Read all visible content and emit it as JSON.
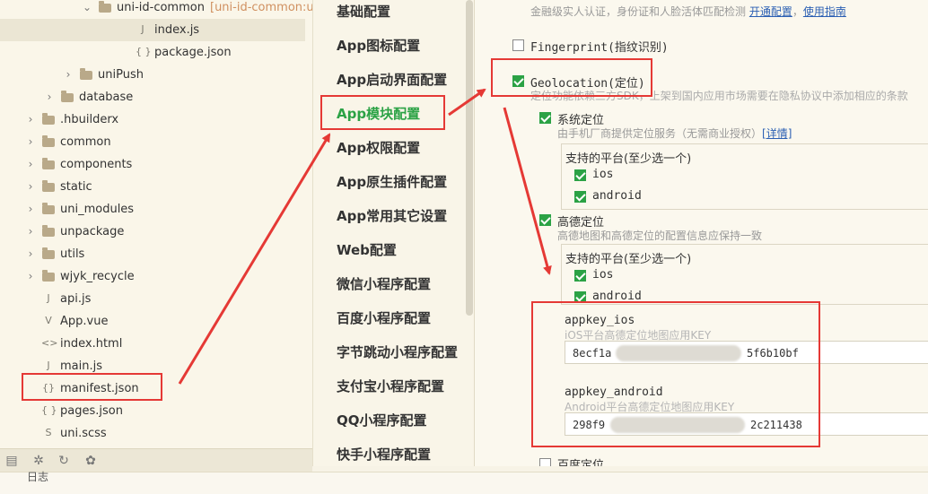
{
  "tree": {
    "rows": [
      {
        "label": "uni-id-common",
        "sublabel": "[uni-id-common:ur",
        "depth": 5,
        "type": "folder",
        "expanded": true
      },
      {
        "label": "index.js",
        "depth": 7,
        "type": "js",
        "selected": true
      },
      {
        "label": "package.json",
        "depth": 7,
        "type": "json"
      },
      {
        "label": "uniPush",
        "depth": 4,
        "type": "folder",
        "expanded": false
      },
      {
        "label": "database",
        "depth": 3,
        "type": "folder",
        "expanded": false
      },
      {
        "label": ".hbuilderx",
        "depth": 2,
        "type": "folder",
        "expanded": false
      },
      {
        "label": "common",
        "depth": 2,
        "type": "folder",
        "expanded": false
      },
      {
        "label": "components",
        "depth": 2,
        "type": "folder",
        "expanded": false
      },
      {
        "label": "static",
        "depth": 2,
        "type": "folder",
        "expanded": false
      },
      {
        "label": "uni_modules",
        "depth": 2,
        "type": "folder",
        "expanded": false
      },
      {
        "label": "unpackage",
        "depth": 2,
        "type": "folder",
        "expanded": false
      },
      {
        "label": "utils",
        "depth": 2,
        "type": "folder",
        "expanded": false
      },
      {
        "label": "wjyk_recycle",
        "depth": 2,
        "type": "folder",
        "expanded": false
      },
      {
        "label": "api.js",
        "depth": 2,
        "type": "js"
      },
      {
        "label": "App.vue",
        "depth": 2,
        "type": "vue"
      },
      {
        "label": "index.html",
        "depth": 2,
        "type": "html"
      },
      {
        "label": "main.js",
        "depth": 2,
        "type": "js"
      },
      {
        "label": "manifest.json",
        "depth": 2,
        "type": "manifest",
        "highlight": true
      },
      {
        "label": "pages.json",
        "depth": 2,
        "type": "json"
      },
      {
        "label": "uni.scss",
        "depth": 2,
        "type": "scss"
      }
    ]
  },
  "statusbar": {
    "icons": [
      "files-icon",
      "bug-icon",
      "search-replace-icon",
      "plugin-icon"
    ]
  },
  "menu": {
    "items": [
      "基础配置",
      "App图标配置",
      "App启动界面配置",
      "App模块配置",
      "App权限配置",
      "App原生插件配置",
      "App常用其它设置",
      "Web配置",
      "微信小程序配置",
      "百度小程序配置",
      "字节跳动小程序配置",
      "支付宝小程序配置",
      "QQ小程序配置",
      "快手小程序配置"
    ],
    "active_index": 3
  },
  "settings": {
    "top_hint": "金融级实人认证，身份证和人脸活体匹配检测",
    "top_link1": "开通配置",
    "top_sep": "，",
    "top_link2": "使用指南",
    "fingerprint_label": "Fingerprint(指纹识别)",
    "fingerprint_checked": false,
    "geo_label": "Geolocation(定位)",
    "geo_checked": true,
    "geo_hint": "定位功能依赖三方SDK，上架到国内应用市场需要在隐私协议中添加相应的条款",
    "system_label": "系统定位",
    "system_checked": true,
    "system_hint": "由手机厂商提供定位服务（无需商业授权）",
    "system_link": "[详情]",
    "platform_title": "支持的平台(至少选一个)",
    "sys_platforms": [
      {
        "name": "ios",
        "checked": true
      },
      {
        "name": "android",
        "checked": true
      }
    ],
    "amap_label": "高德定位",
    "amap_checked": true,
    "amap_hint": "高德地图和高德定位的配置信息应保持一致",
    "amap_platform_title": "支持的平台(至少选一个)",
    "amap_platforms": [
      {
        "name": "ios",
        "checked": true
      },
      {
        "name": "android",
        "checked": true
      }
    ],
    "appkey_ios_label": "appkey_ios",
    "appkey_ios_hint": "iOS平台高德定位地图应用KEY",
    "appkey_ios_prefix": "8ecf1a",
    "appkey_ios_suffix": "5f6b10bf",
    "appkey_android_label": "appkey_android",
    "appkey_android_hint": "Android平台高德定位地图应用KEY",
    "appkey_android_prefix": "298f9",
    "appkey_android_suffix": "2c211438",
    "baidu_label": "百度定位",
    "baidu_checked": false
  },
  "bottom_text": "日志"
}
